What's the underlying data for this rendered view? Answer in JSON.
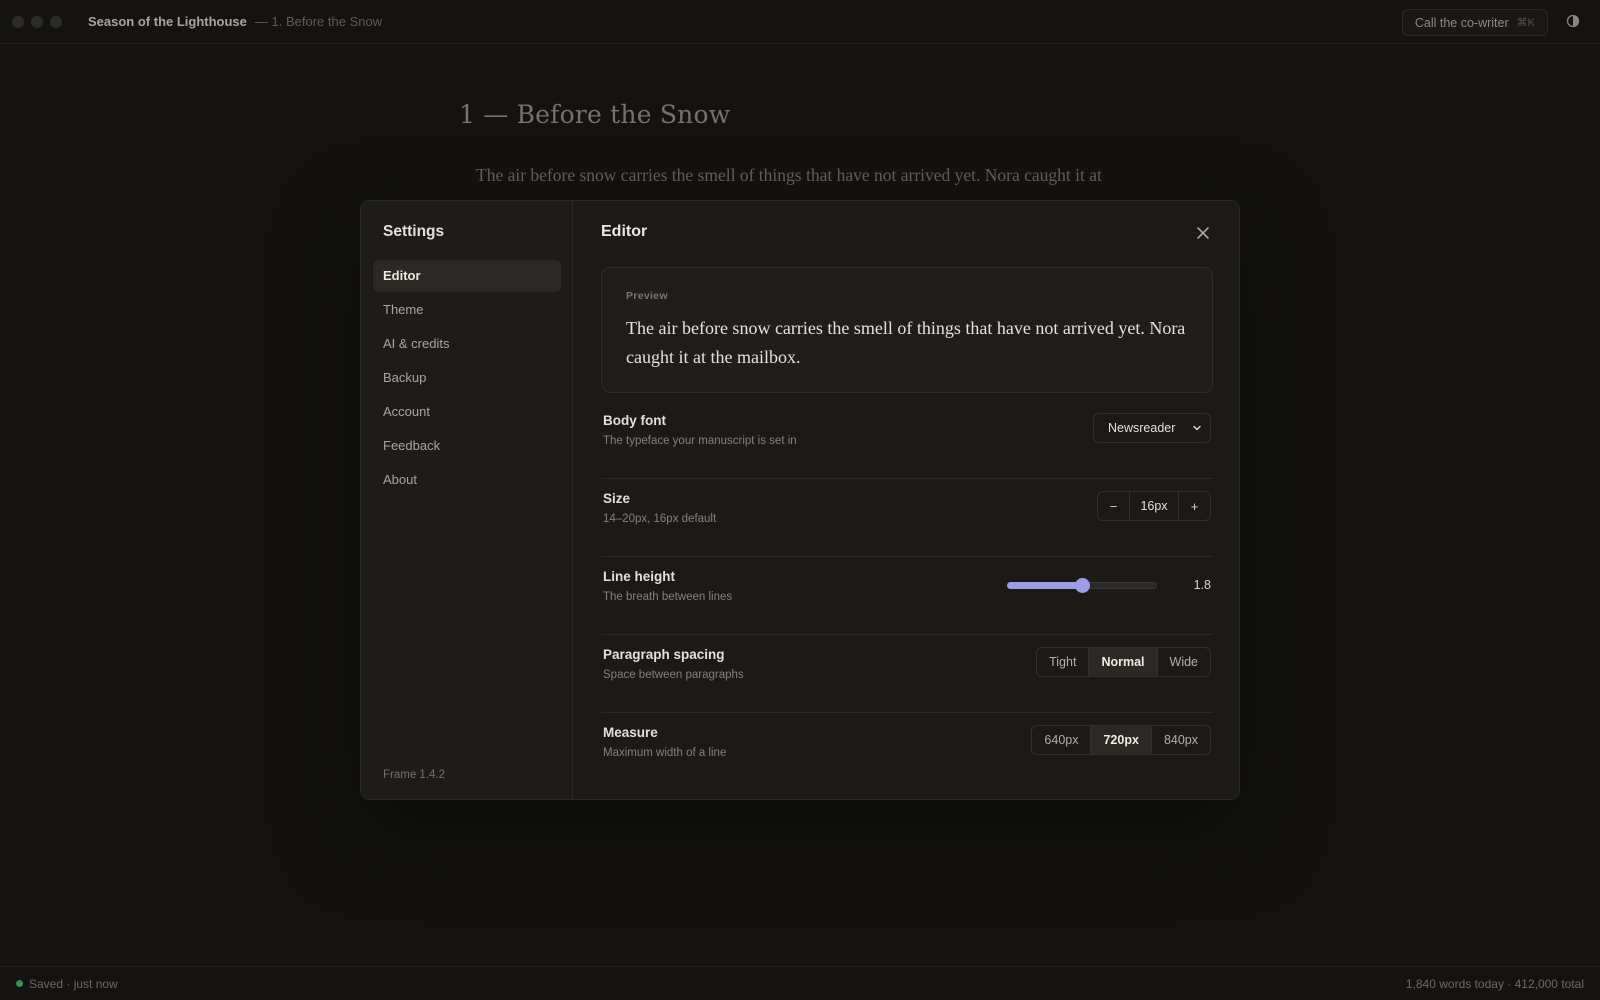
{
  "titlebar": {
    "project_title": "Season of the Lighthouse",
    "chapter_subtitle": "— 1. Before the Snow",
    "cowriter_label": "Call the co-writer",
    "cowriter_shortcut": "⌘K"
  },
  "document": {
    "chapter_heading": "1 — Before the Snow",
    "first_line": "The air before snow carries the smell of things that have not arrived yet. Nora caught it at"
  },
  "settings": {
    "title": "Settings",
    "nav": [
      {
        "label": "Editor",
        "active": true
      },
      {
        "label": "Theme"
      },
      {
        "label": "AI & credits"
      },
      {
        "label": "Backup"
      },
      {
        "label": "Account"
      },
      {
        "label": "Feedback"
      },
      {
        "label": "About"
      }
    ],
    "version": "Frame 1.4.2",
    "section_title": "Editor",
    "preview": {
      "label": "Preview",
      "text": "The air before snow carries the smell of things that have not arrived yet. Nora caught it at the mailbox."
    },
    "body_font": {
      "label": "Body font",
      "description": "The typeface your manuscript is set in",
      "value": "Newsreader"
    },
    "size": {
      "label": "Size",
      "description": "14–20px, 16px default",
      "value": "16px",
      "decrement": "−",
      "increment": "+"
    },
    "line_height": {
      "label": "Line height",
      "description": "The breath between lines",
      "value": "1.8",
      "fill_fraction": 0.5
    },
    "paragraph_spacing": {
      "label": "Paragraph spacing",
      "description": "Space between paragraphs",
      "options": [
        "Tight",
        "Normal",
        "Wide"
      ],
      "selected": "Normal"
    },
    "measure": {
      "label": "Measure",
      "description": "Maximum width of a line",
      "options": [
        "640px",
        "720px",
        "840px"
      ],
      "selected": "720px"
    }
  },
  "statusbar": {
    "saved": "Saved · just now",
    "words": "1,840 words today · 412,000 total"
  },
  "colors": {
    "accent": "#9d9ee6",
    "saved_dot": "#3f8a5a",
    "background": "#141311"
  }
}
